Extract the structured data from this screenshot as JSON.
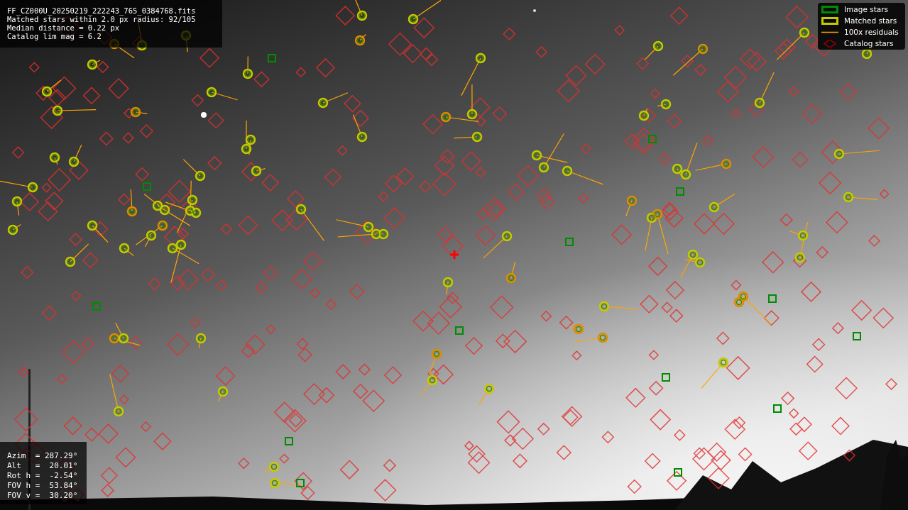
{
  "info": {
    "lines": [
      "FF_CZ000U_20250219_222243_765_0384768.fits",
      "Matched stars within 2.0 px radius: 92/105",
      "Median distance = 0.22 px",
      "Catalog lim mag = 6.2"
    ]
  },
  "legend": [
    {
      "label": "Image stars",
      "color": "#008c00"
    },
    {
      "kind": "matched",
      "label": "Matched stars",
      "color": "#c8c800"
    },
    {
      "kind": "residual",
      "label": "100x residuals",
      "color": "#ffa500"
    },
    {
      "kind": "catalog",
      "label": "Catalog stars",
      "color": "#a00000"
    }
  ],
  "pointing": {
    "lines": [
      "Azim  = 287.29°",
      "Alt   =  20.01°",
      "Rot h =  -2.54°",
      "FOV h =  53.84°",
      "FOV v =  30.20°"
    ]
  }
}
